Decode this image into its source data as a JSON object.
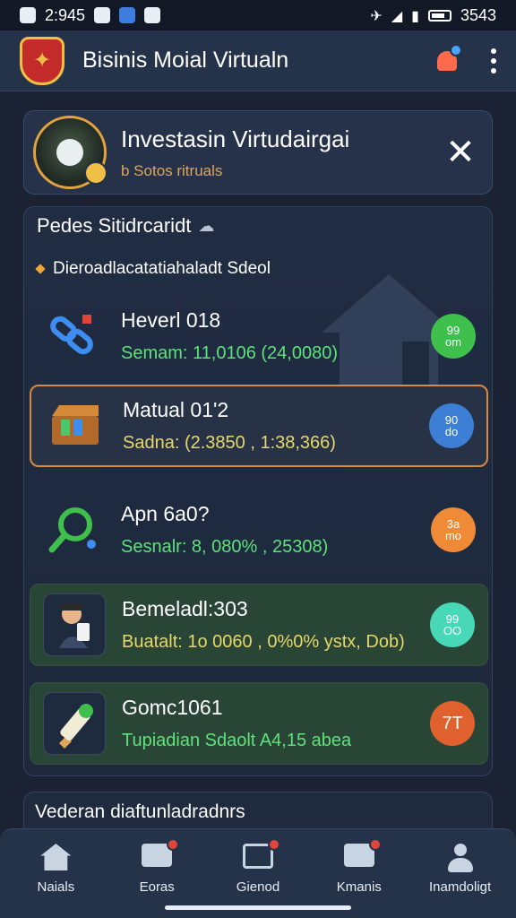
{
  "status_bar": {
    "time": "2:945",
    "clock_right": "3543",
    "icons": [
      "photo-icon",
      "square-icon",
      "telegram-icon",
      "clock-icon",
      "no-sound-icon",
      "wifi-icon",
      "signal-icon",
      "battery-icon"
    ]
  },
  "app_bar": {
    "title": "Bisinis Moial Virtualn",
    "logo_icon": "crest-logo",
    "actions": [
      "notification-icon",
      "more-vert-icon"
    ]
  },
  "banner": {
    "title": "Investasin Virtudairgai",
    "subtitle": "b Sotos ritruals",
    "close_glyph": "✕"
  },
  "panel": {
    "header": "Pedes Sitidrcaridt",
    "header_icon_glyph": "☁",
    "subheader": "Dieroadlacatatiahaladt Sdeol",
    "items": [
      {
        "name": "Heverl 018",
        "detail": "Semam: 11,0106 (24,0080)",
        "detail_color": "#5fe27a",
        "badge": "99\nom",
        "badge_color": "#3fbf4c"
      },
      {
        "name": "Matual 01'2",
        "detail": "Sadna: (2.3850 , 1:38,366)",
        "detail_color": "#e6d86a",
        "badge": "90\ndo",
        "badge_color": "#3d7fd4"
      },
      {
        "name": "Apn 6a0?",
        "detail": "Sesnalr: 8, 080% , 25308)",
        "detail_color": "#5fe27a",
        "badge": "3a\nmo",
        "badge_color": "#ef8a37"
      },
      {
        "name": "Bemeladl:303",
        "detail": "Buatalt: 1o 0060 , 0%0% ystx, Dob)",
        "detail_color": "#e6d86a",
        "badge": "99\nOO",
        "badge_color": "#48d8b8"
      },
      {
        "name": "Gomc1061",
        "detail": "Tupiadian Sdaolt A4,15 abea",
        "detail_color": "#5fe27a",
        "badge": "7T",
        "badge_color": "#e0612e"
      }
    ]
  },
  "bottom_card": {
    "text": "Vederan diaftunladradnrs"
  },
  "nav": {
    "items": [
      {
        "label": "Naials",
        "icon": "home-icon",
        "dot": false
      },
      {
        "label": "Eoras",
        "icon": "chat-icon",
        "dot": true
      },
      {
        "label": "Gienod",
        "icon": "document-icon",
        "dot": true
      },
      {
        "label": "Kmanis",
        "icon": "camera-icon",
        "dot": true
      },
      {
        "label": "Inamdoligt",
        "icon": "user-icon",
        "dot": false
      }
    ]
  }
}
